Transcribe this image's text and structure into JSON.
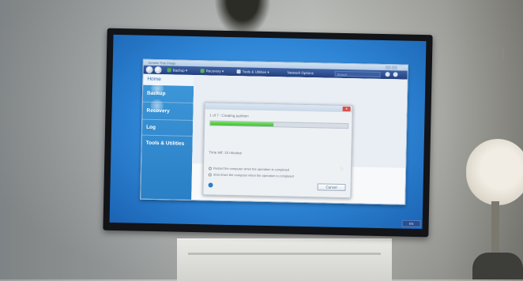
{
  "app": {
    "window_title": "Acronis True Image",
    "toolbar": {
      "items": [
        {
          "label": "Backup",
          "icon": "backup-icon",
          "color": "#4fb14a"
        },
        {
          "label": "Recovery",
          "icon": "recovery-icon",
          "color": "#59b64f"
        },
        {
          "label": "Tools & Utilities",
          "icon": "tools-icon",
          "color": "#cdd9ea"
        },
        {
          "label": "Network Options",
          "icon": "network-icon",
          "color": "#cdd9ea"
        }
      ],
      "search_placeholder": "Search"
    },
    "sidebar": {
      "items": [
        {
          "label": "Home",
          "selected": true
        },
        {
          "label": "Backup"
        },
        {
          "label": "Recovery"
        },
        {
          "label": "Log"
        },
        {
          "label": "Tools & Utilities"
        }
      ]
    }
  },
  "dialog": {
    "status_text": "1 of 7 : Creating partition",
    "progress_percent": 46,
    "time_left_text": "Time left: 15 minutes",
    "options": [
      {
        "label": "Restart the computer when the operation is completed",
        "selected": false
      },
      {
        "label": "Shut down the computer when the operation is completed",
        "selected": false
      }
    ],
    "cancel_label": "Cancel",
    "close_label": "x"
  },
  "tray": {
    "label": "EN"
  },
  "colors": {
    "desktop": "#2f86d6",
    "toolbar": "#233f7d",
    "sidebar": "#2a7fc5",
    "progress": "#3fbf2f"
  }
}
